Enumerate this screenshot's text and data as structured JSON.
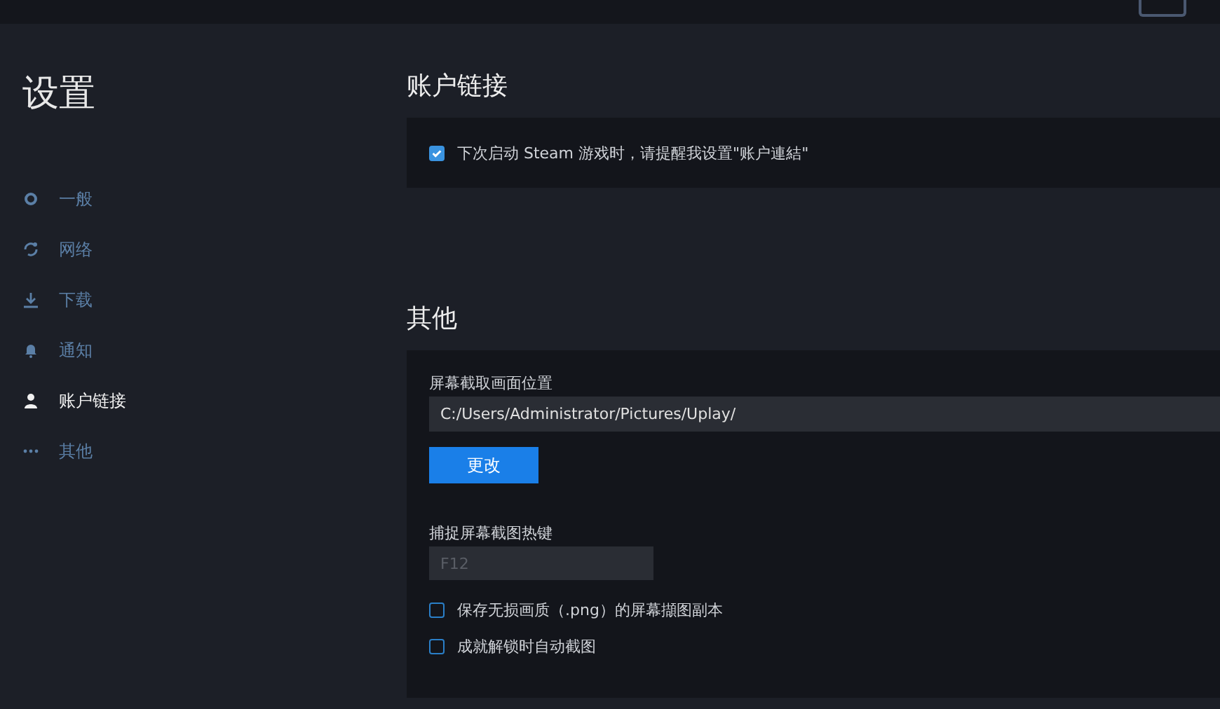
{
  "sidebar": {
    "title": "设置",
    "items": [
      {
        "label": "一般",
        "kind": "gear",
        "selected": false
      },
      {
        "label": "网络",
        "kind": "network",
        "selected": false
      },
      {
        "label": "下载",
        "kind": "download",
        "selected": false
      },
      {
        "label": "通知",
        "kind": "bell",
        "selected": false
      },
      {
        "label": "账户链接",
        "kind": "person",
        "selected": true
      },
      {
        "label": "其他",
        "kind": "dots",
        "selected": false
      }
    ]
  },
  "sections": [
    {
      "title": "账户链接",
      "rows": [
        {
          "kind": "checkbox",
          "label": "下次启动 Steam 游戏时，请提醒我设置\"账户連結\"",
          "checked": true
        }
      ]
    },
    {
      "title": "其他",
      "rows": [
        {
          "kind": "label",
          "label": "屏幕截取画面位置"
        },
        {
          "kind": "path",
          "value": "C:/Users/Administrator/Pictures/Uplay/"
        },
        {
          "kind": "button",
          "label": "更改"
        },
        {
          "kind": "label",
          "label": "捕捉屏幕截图热键"
        },
        {
          "kind": "hotkey",
          "value": "F12",
          "disabled": true
        },
        {
          "kind": "checkbox",
          "label": "保存无损画质（.png）的屏幕擷图副本",
          "checked": false
        },
        {
          "kind": "checkbox",
          "label": "成就解锁时自动截图",
          "checked": false
        }
      ]
    }
  ]
}
